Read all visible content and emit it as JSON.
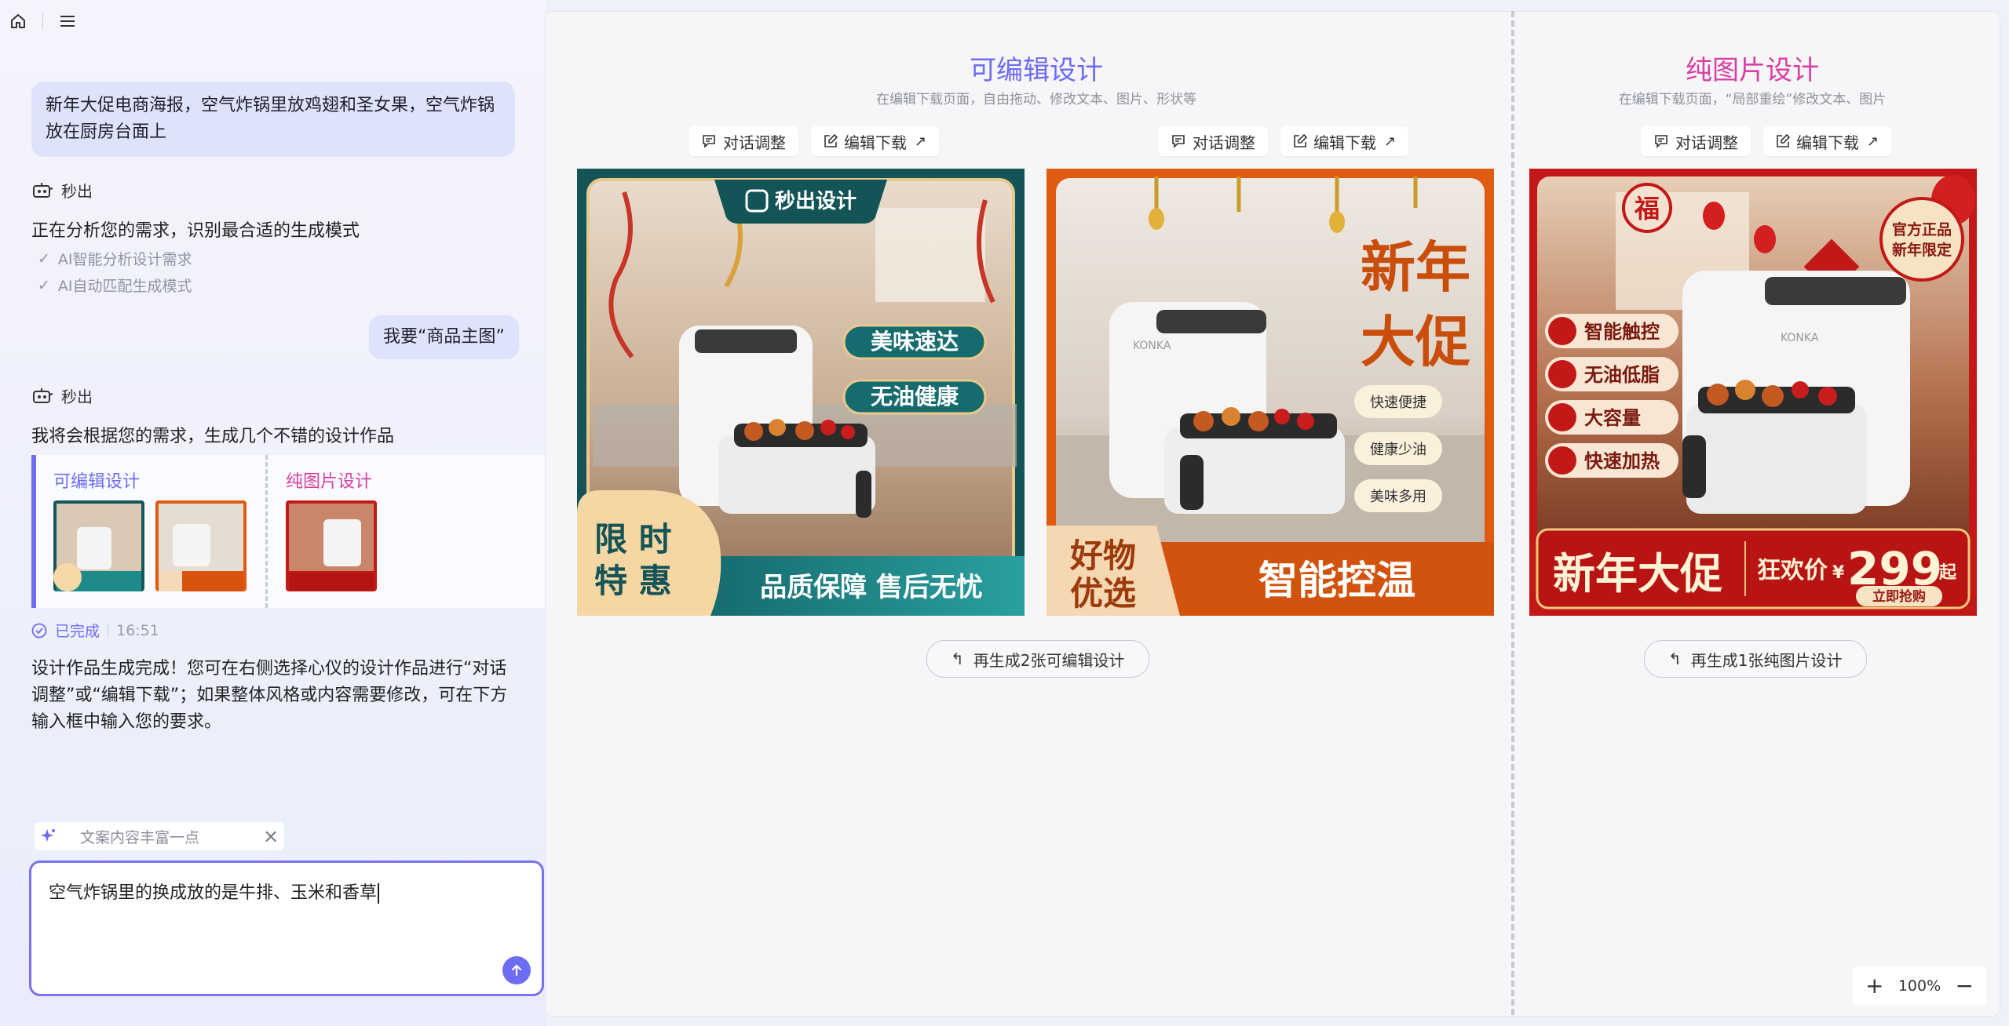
{
  "colors": {
    "accent": "#6d6cf3",
    "pink": "#d93fa0"
  },
  "topbar": {
    "home_icon": "home-icon",
    "menu_icon": "menu-icon"
  },
  "chat": {
    "user_msg_1": "新年大促电商海报，空气炸锅里放鸡翅和圣女果，空气炸锅放在厨房台面上",
    "bot_name": "秒出",
    "bot_msg_1": "正在分析您的需求，识别最合适的生成模式",
    "checks": [
      "AI智能分析设计需求",
      "AI自动匹配生成模式"
    ],
    "user_msg_2": "我要“商品主图”",
    "bot_msg_2": "我将会根据您的需求，生成几个不错的设计作品",
    "gen_card": {
      "editable_label": "可编辑设计",
      "image_label": "纯图片设计"
    },
    "status": {
      "done": "已完成",
      "time": "16:51"
    },
    "final_msg": "设计作品生成完成！您可在右侧选择心仪的设计作品进行“对话调整”或“编辑下载”；如果整体风格或内容需要修改，可在下方输入框中输入您的要求。",
    "chip_text": "文案内容丰富一点",
    "input_value": "空气炸锅里的换成放的是牛排、玉米和香草"
  },
  "sections": {
    "editable": {
      "title": "可编辑设计",
      "subtitle": "在编辑下载页面，自由拖动、修改文本、图片、形状等",
      "regen": "再生成2张可编辑设计"
    },
    "image": {
      "title": "纯图片设计",
      "subtitle": "在编辑下载页面，“局部重绘”修改文本、图片",
      "regen": "再生成1张纯图片设计"
    }
  },
  "tools": {
    "chat_adjust": "对话调整",
    "edit_download": "编辑下载"
  },
  "posters": {
    "p1": {
      "logo": "秒出设计",
      "tag1": "美味速达",
      "tag2": "无油健康",
      "promo_line1": "限 时",
      "promo_line2": "特 惠",
      "bottom": "品质保障 售后无忧"
    },
    "p2": {
      "title1": "新年",
      "title2": "大促",
      "pills": [
        "快速便捷",
        "健康少油",
        "美味多用"
      ],
      "brand": "KONKA",
      "corner1": "好物",
      "corner2": "优选",
      "bottom": "智能控温"
    },
    "p3": {
      "badge1": "官方正品",
      "badge2": "新年限定",
      "fu": "福",
      "brand": "KONKA",
      "features": [
        "智能触控",
        "无油低脂",
        "大容量",
        "快速加热"
      ],
      "banner": "新年大促",
      "price_label": "狂欢价",
      "currency": "¥",
      "price": "299",
      "price_suffix": "起",
      "cta": "立即抢购"
    }
  },
  "zoom": {
    "level": "100%"
  }
}
